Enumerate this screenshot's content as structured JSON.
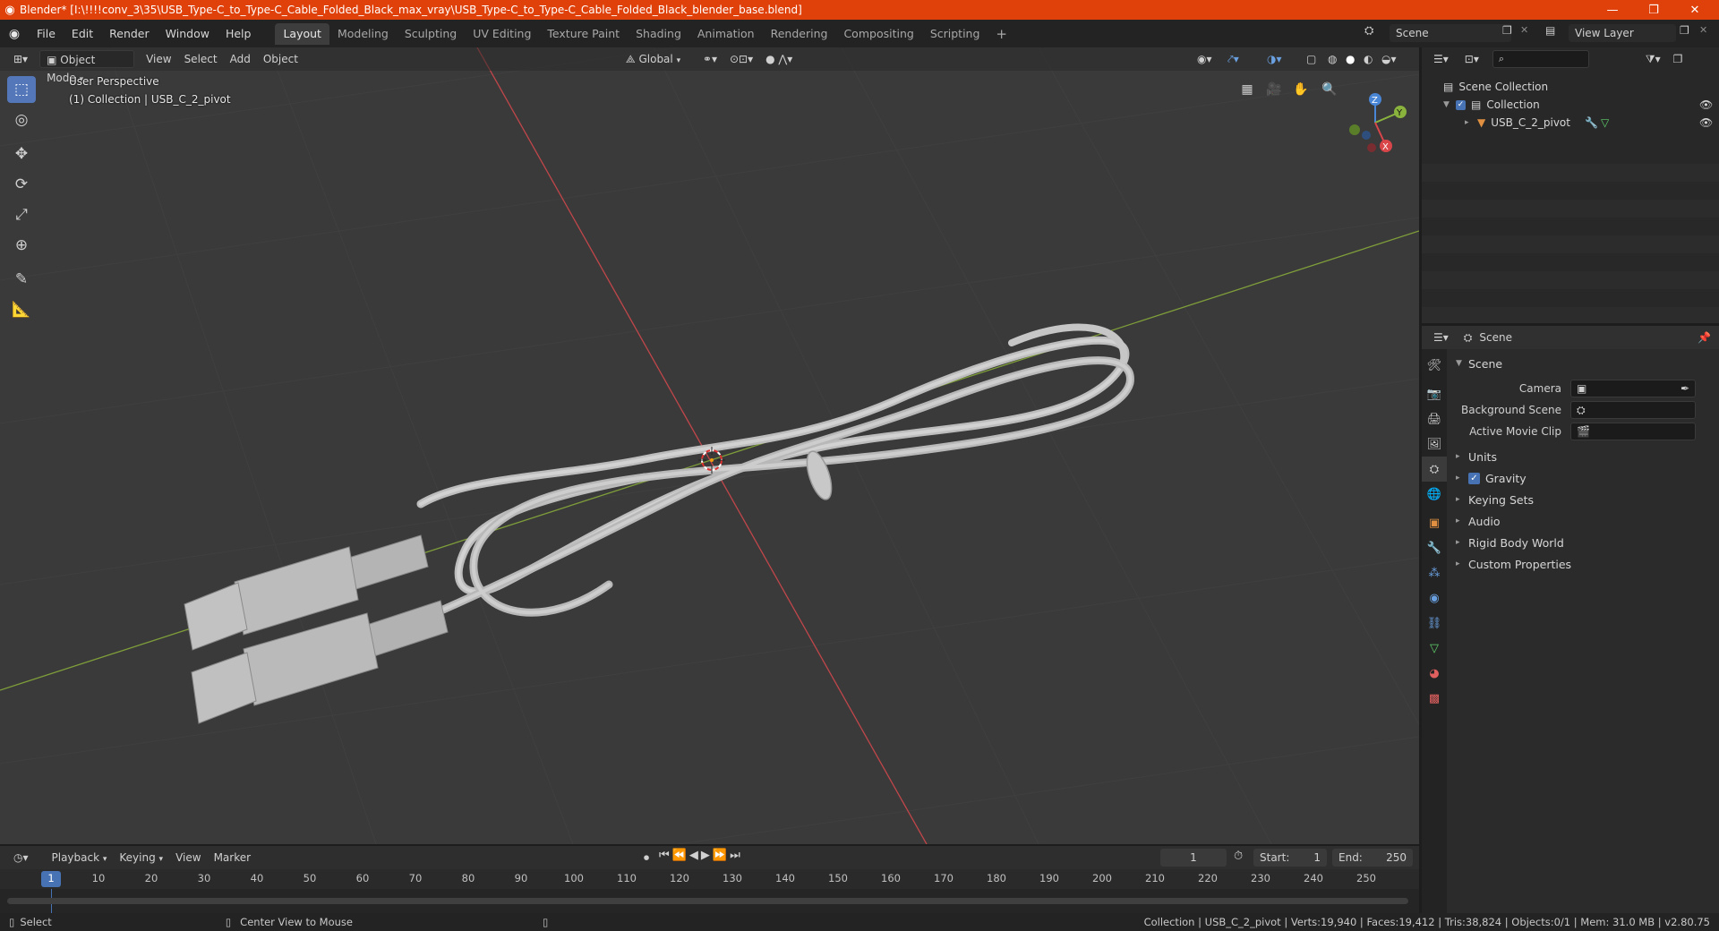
{
  "titlebar": {
    "title": "Blender* [I:\\!!!!conv_3\\35\\USB_Type-C_to_Type-C_Cable_Folded_Black_max_vray\\USB_Type-C_to_Type-C_Cable_Folded_Black_blender_base.blend]",
    "minimize": "—",
    "restore": "❐",
    "close": "✕"
  },
  "menu": [
    "File",
    "Edit",
    "Render",
    "Window",
    "Help"
  ],
  "workspaces": [
    "Layout",
    "Modeling",
    "Sculpting",
    "UV Editing",
    "Texture Paint",
    "Shading",
    "Animation",
    "Rendering",
    "Compositing",
    "Scripting"
  ],
  "workspace_add": "+",
  "scene_field": "Scene",
  "view_layer_field": "View Layer",
  "viewport": {
    "mode": "Object Mode",
    "menus": [
      "View",
      "Select",
      "Add",
      "Object"
    ],
    "transform_orientation": "Global",
    "perspective_label": "User Perspective",
    "collection_label": "(1) Collection | USB_C_2_pivot",
    "gizmo": {
      "z": "Z",
      "y": "Y",
      "x": "X"
    }
  },
  "outliner": {
    "search_placeholder": "",
    "root": "Scene Collection",
    "collection": "Collection",
    "object": "USB_C_2_pivot"
  },
  "properties": {
    "header_title": "Scene",
    "section": "Scene",
    "fields": [
      {
        "label": "Camera",
        "value": ""
      },
      {
        "label": "Background Scene",
        "value": ""
      },
      {
        "label": "Active Movie Clip",
        "value": ""
      }
    ],
    "subsections": [
      "Units",
      "Gravity",
      "Keying Sets",
      "Audio",
      "Rigid Body World",
      "Custom Properties"
    ],
    "gravity_checked": true
  },
  "timeline": {
    "menus": [
      "Playback",
      "Keying",
      "View",
      "Marker"
    ],
    "current_frame": "1",
    "start_label": "Start:",
    "start": "1",
    "end_label": "End:",
    "end": "250",
    "ticks": [
      "1",
      "10",
      "20",
      "30",
      "40",
      "50",
      "60",
      "70",
      "80",
      "90",
      "100",
      "110",
      "120",
      "130",
      "140",
      "150",
      "160",
      "170",
      "180",
      "190",
      "200",
      "210",
      "220",
      "230",
      "240",
      "250"
    ]
  },
  "statusbar": {
    "left_action": "Select",
    "middle_action": "Center View to Mouse",
    "stats": "Collection | USB_C_2_pivot | Verts:19,940 | Faces:19,412 | Tris:38,824 | Objects:0/1 | Mem: 31.0 MB | v2.80.75"
  },
  "colors": {
    "titlebar": "#e0410a",
    "viewport_bg": "#3a3a3a",
    "active_blue": "#4772b3",
    "x_axis": "#d9464a",
    "y_axis": "#8ab33e",
    "z_axis": "#4a86d6"
  }
}
